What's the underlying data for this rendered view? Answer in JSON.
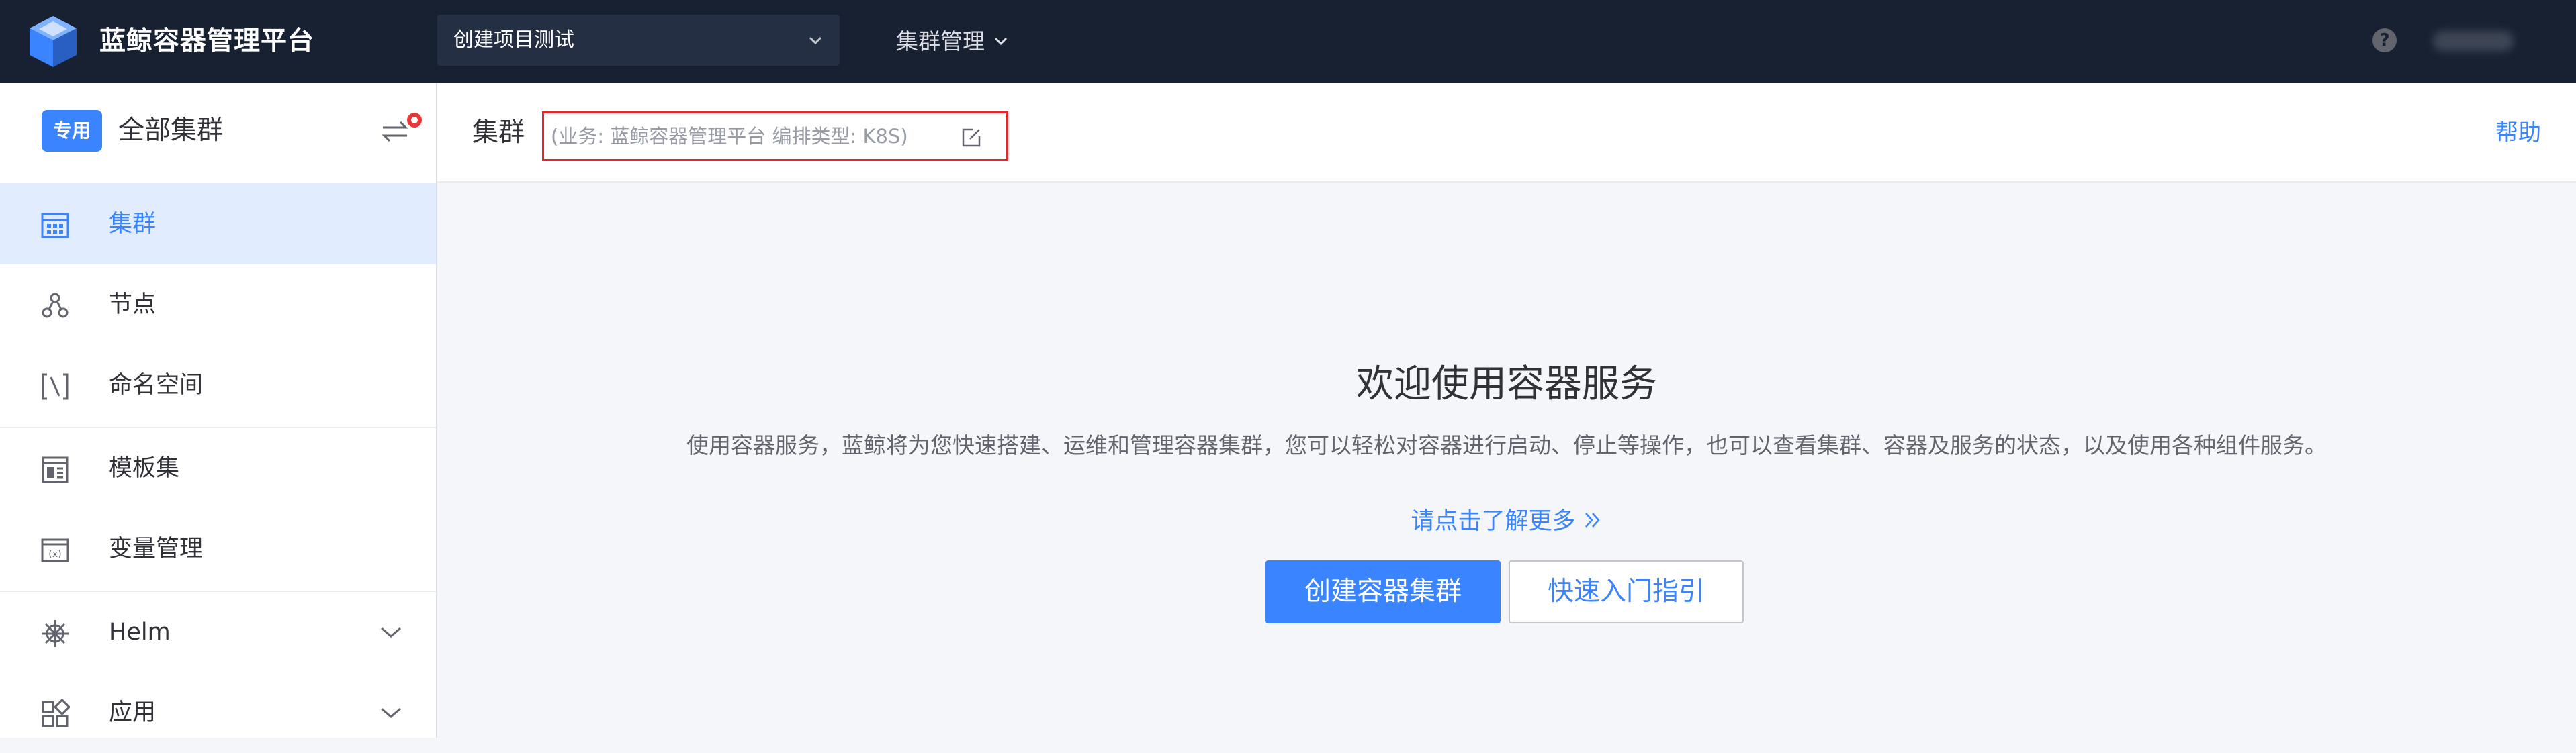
{
  "header": {
    "brand": "蓝鲸容器管理平台",
    "project_select": "创建项目测试",
    "nav_cluster": "集群管理",
    "help_icon": "?"
  },
  "sidebar": {
    "tag": "专用",
    "scope": "全部集群",
    "items": [
      {
        "label": "集群",
        "icon": "cluster-grid-icon",
        "active": true
      },
      {
        "label": "节点",
        "icon": "node-icon"
      },
      {
        "label": "命名空间",
        "icon": "namespace-icon"
      },
      {
        "label": "模板集",
        "icon": "template-icon"
      },
      {
        "label": "变量管理",
        "icon": "variable-icon"
      },
      {
        "label": "Helm",
        "icon": "helm-icon",
        "expandable": true
      },
      {
        "label": "应用",
        "icon": "app-icon",
        "expandable": true
      }
    ]
  },
  "content": {
    "title": "集群",
    "meta": "(业务: 蓝鲸容器管理平台    编排类型: K8S)",
    "help": "帮助"
  },
  "welcome": {
    "title": "欢迎使用容器服务",
    "description": "使用容器服务，蓝鲸将为您快速搭建、运维和管理容器集群，您可以轻松对容器进行启动、停止等操作，也可以查看集群、容器及服务的状态，以及使用各种组件服务。",
    "learn_more": "请点击了解更多",
    "create_button": "创建容器集群",
    "guide_button": "快速入门指引"
  },
  "colors": {
    "topbar": "#182132",
    "accent": "#3a84ff",
    "highlight_box": "#e5252a",
    "active_bg": "#e1ecff"
  }
}
